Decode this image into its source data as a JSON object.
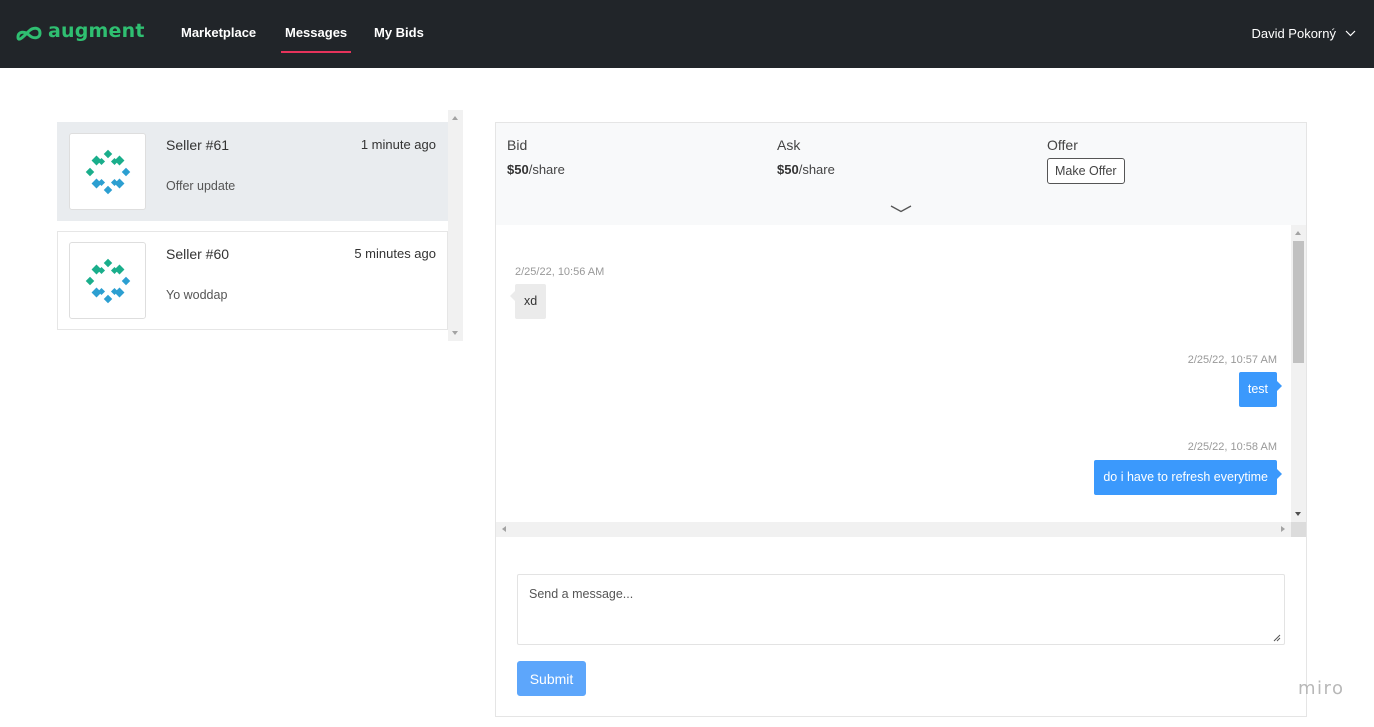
{
  "brand": {
    "name": "augment",
    "color": "#2fbf71"
  },
  "nav": {
    "items": [
      {
        "label": "Marketplace",
        "active": false
      },
      {
        "label": "Messages",
        "active": true
      },
      {
        "label": "My Bids",
        "active": false
      }
    ],
    "accent": "#e6335b",
    "user_name": "David Pokorný"
  },
  "conversations": [
    {
      "name": "Seller #61",
      "time": "1 minute ago",
      "preview": "Offer update",
      "selected": true,
      "avatar": "teal-diamond-logo-icon"
    },
    {
      "name": "Seller #60",
      "time": "5 minutes ago",
      "preview": "Yo woddap",
      "selected": false,
      "avatar": "teal-diamond-logo-icon"
    }
  ],
  "offer": {
    "bid": {
      "label": "Bid",
      "amount": "$50",
      "unit": "/share"
    },
    "ask": {
      "label": "Ask",
      "amount": "$50",
      "unit": "/share"
    },
    "offer": {
      "label": "Offer",
      "button": "Make Offer"
    }
  },
  "messages": [
    {
      "time": "2/25/22, 10:56 AM",
      "text": "xd",
      "direction": "in"
    },
    {
      "time": "2/25/22, 10:57 AM",
      "text": "test",
      "direction": "out"
    },
    {
      "time": "2/25/22, 10:58 AM",
      "text": "do i have to refresh everytime",
      "direction": "out"
    }
  ],
  "composer": {
    "placeholder": "Send a message...",
    "submit_label": "Submit",
    "submit_color": "#5da6fb"
  },
  "watermark": "miro"
}
